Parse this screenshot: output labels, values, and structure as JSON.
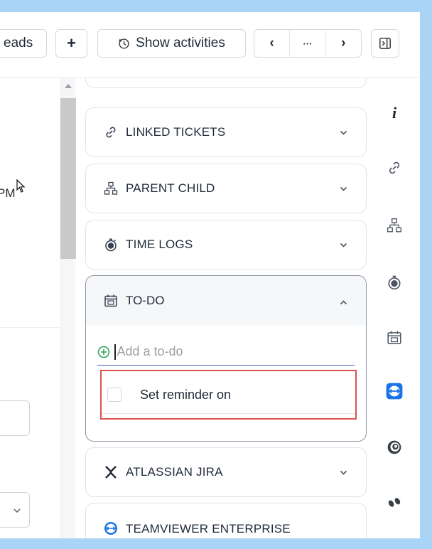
{
  "toolbar": {
    "threads_label": "eads",
    "add_label": "+",
    "show_activities_label": "Show activities",
    "prev_label": "‹",
    "more_label": "···",
    "next_label": "›"
  },
  "left_pane": {
    "partial_text": "PM"
  },
  "panels": {
    "linked_tickets": "LINKED TICKETS",
    "parent_child": "PARENT CHILD",
    "time_logs": "TIME LOGS",
    "todo": "TO-DO",
    "atlassian_jira": "ATLASSIAN JIRA",
    "teamviewer": "TEAMVIEWER ENTERPRISE INTEGRATION"
  },
  "todo_widget": {
    "input_placeholder": "Add a to-do",
    "reminder_label": "Set reminder on"
  },
  "colors": {
    "accent": "#3b5cc4",
    "highlight_border": "#d9534f",
    "teamviewer_blue": "#1a73e8",
    "add_icon_green": "#2e9e5b"
  }
}
